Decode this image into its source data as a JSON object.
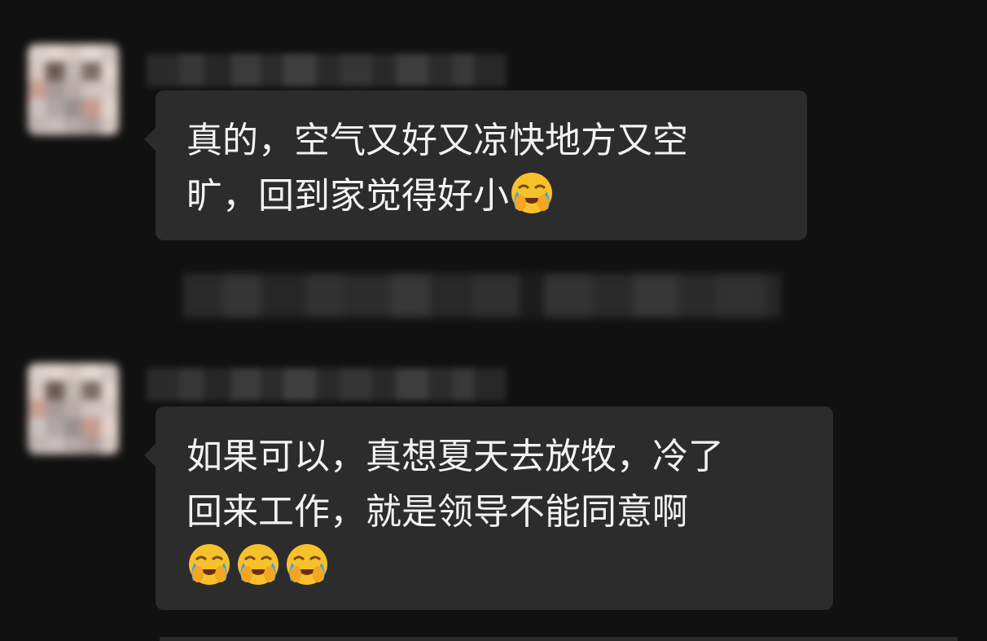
{
  "chat": {
    "messages": [
      {
        "lines": [
          "真的，空气又好又凉快地方又空",
          "旷，回到家觉得好小"
        ],
        "emojis": [
          "face-with-tears-emoji"
        ]
      },
      {
        "lines": [
          "如果可以，真想夏天去放牧，冷了",
          "回来工作，就是领导不能同意啊",
          ""
        ],
        "emojis": [
          "face-with-tears-emoji",
          "face-with-tears-emoji",
          "face-with-tears-emoji"
        ]
      }
    ]
  },
  "colors": {
    "background": "#111111",
    "bubble": "#2c2c2c",
    "text": "#f2f2f2",
    "emoji_face": "#f7c12b"
  }
}
